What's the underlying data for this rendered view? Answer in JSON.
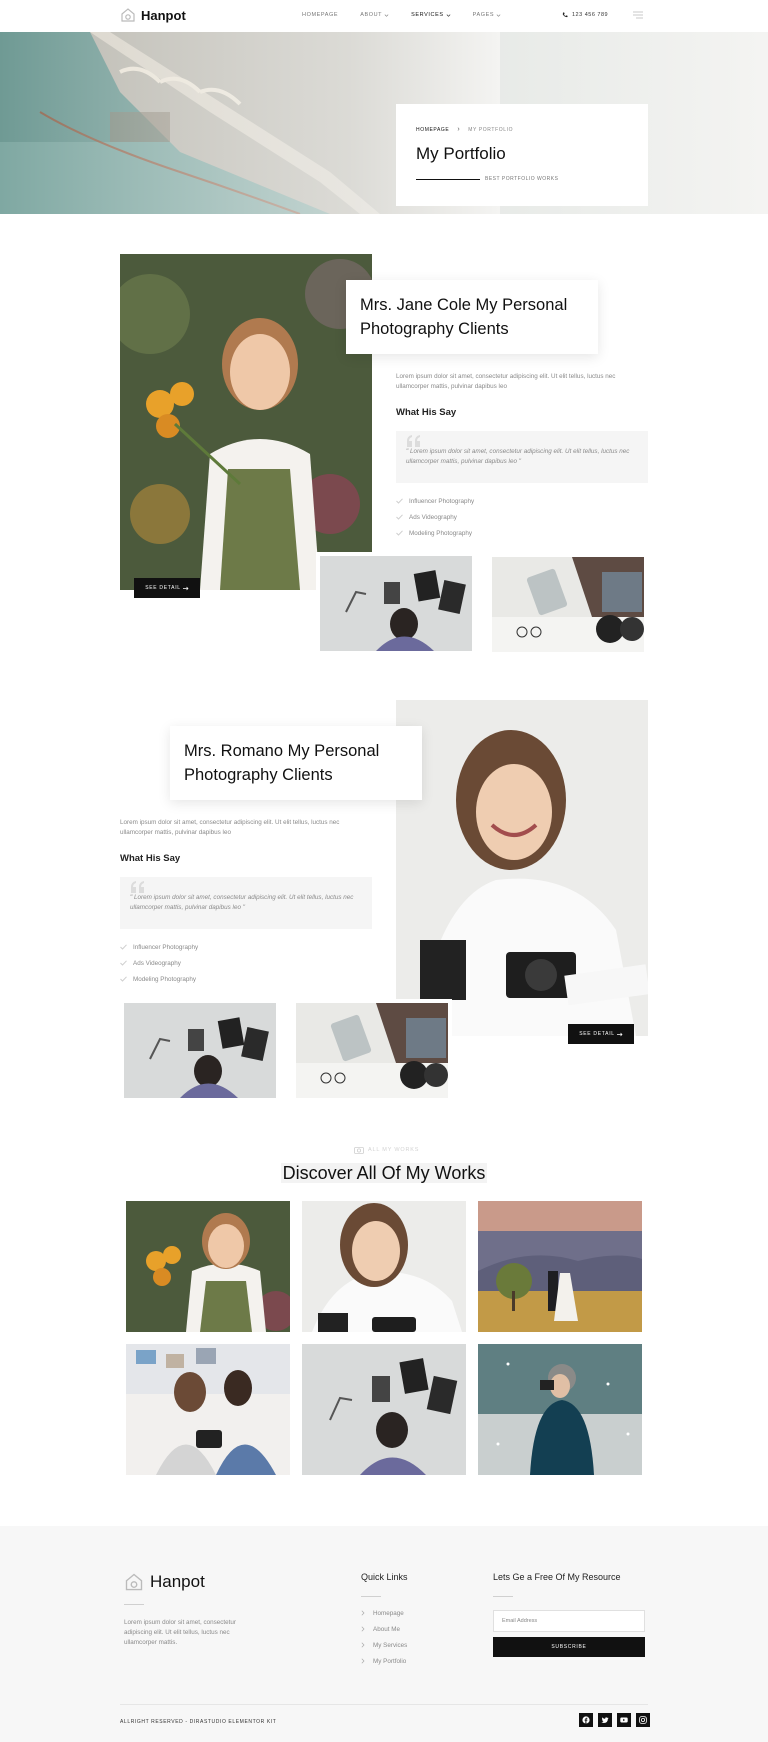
{
  "header": {
    "brand": "Hanpot",
    "nav": [
      {
        "label": "HOMEPAGE",
        "has_dropdown": false
      },
      {
        "label": "ABOUT",
        "has_dropdown": true
      },
      {
        "label": "SERVICES",
        "has_dropdown": true
      },
      {
        "label": "PAGES",
        "has_dropdown": true
      }
    ],
    "phone": "123 456 789",
    "menu_icon": "hamburger-icon"
  },
  "hero": {
    "breadcrumb_home": "HOMEPAGE",
    "breadcrumb_sep": "›",
    "breadcrumb_current": "MY PORTFOLIO",
    "title": "My Portfolio",
    "subtitle": "BEST PORTFOLIO WORKS"
  },
  "section1": {
    "title": "Mrs. Jane Cole My Personal Photography Clients",
    "paragraph": "Lorem ipsum dolor sit amet, consectetur adipiscing elit. Ut elit tellus, luctus nec ullamcorper mattis, pulvinar dapibus leo",
    "say_heading": "What His Say",
    "quote": "\" Lorem ipsum dolor sit amet, consectetur adipiscing elit. Ut elit tellus, luctus nec ullamcorper mattis, pulvinar dapibus leo \"",
    "list": [
      "Influencer Photography",
      "Ads Videography",
      "Modeling Photography"
    ],
    "button": "SEE DETAIL"
  },
  "section2": {
    "title": "Mrs. Romano My Personal Photography Clients",
    "paragraph": "Lorem ipsum dolor sit amet, consectetur adipiscing elit. Ut elit tellus, luctus nec ullamcorper mattis, pulvinar dapibus leo",
    "say_heading": "What His Say",
    "quote": "\" Lorem ipsum dolor sit amet, consectetur adipiscing elit. Ut elit tellus, luctus nec ullamcorper mattis, pulvinar dapibus leo \"",
    "list": [
      "Influencer Photography",
      "Ads Videography",
      "Modeling Photography"
    ],
    "button": "SEE DETAIL"
  },
  "works": {
    "kicker": "ALL MY WORKS",
    "title": "Discover All Of My Works"
  },
  "footer": {
    "brand": "Hanpot",
    "about": "Lorem ipsum dolor sit amet, consectetur adipiscing elit. Ut elit tellus, luctus nec ullamcorper mattis.",
    "quick_links_heading": "Quick Links",
    "quick_links": [
      "Homepage",
      "About Me",
      "My Services",
      "My Portfolio"
    ],
    "newsletter_heading": "Lets Ge a Free Of My Resource",
    "email_placeholder": "Email Address",
    "subscribe": "SUBSCRIBE",
    "copyright": "ALLRIGHT RESERVED - DIRASTUDIO ELEMENTOR KIT",
    "social": [
      "facebook-icon",
      "twitter-icon",
      "youtube-icon",
      "instagram-icon"
    ]
  },
  "colors": {
    "accent": "#111111",
    "text_muted": "#8a8a8a",
    "quote_bg": "#f5f5f5",
    "footer_bg": "#f7f7f7"
  }
}
